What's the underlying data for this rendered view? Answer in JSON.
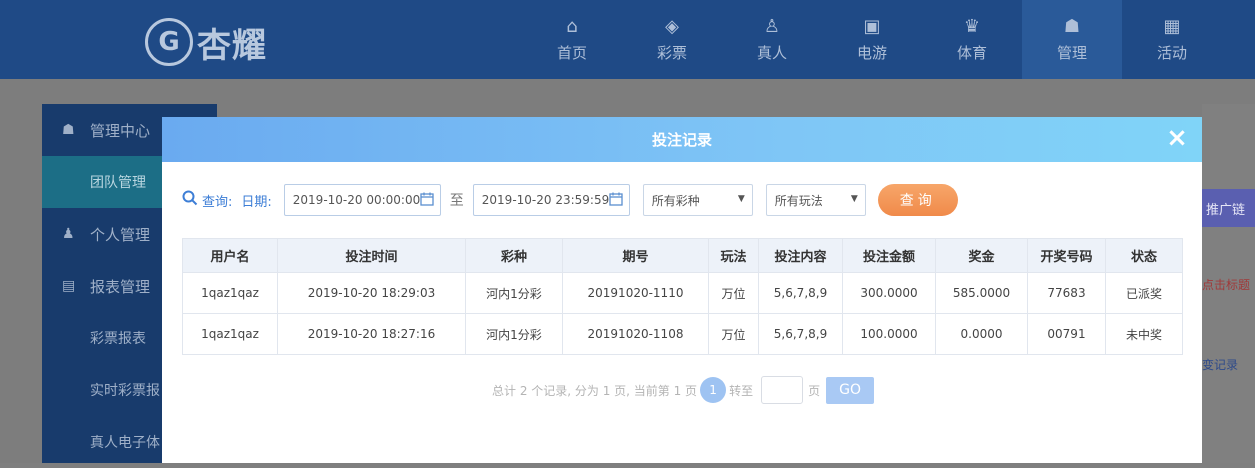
{
  "brand": {
    "emblem": "G",
    "name": "杏耀"
  },
  "nav": [
    {
      "label": "首页",
      "icon": "home-icon",
      "glyph": "⌂"
    },
    {
      "label": "彩票",
      "icon": "ticket-icon",
      "glyph": "◈"
    },
    {
      "label": "真人",
      "icon": "user-icon",
      "glyph": "♙"
    },
    {
      "label": "电游",
      "icon": "slot-machine-icon",
      "glyph": "▣"
    },
    {
      "label": "体育",
      "icon": "trophy-icon",
      "glyph": "♛"
    },
    {
      "label": "管理",
      "icon": "group-icon",
      "glyph": "☗"
    },
    {
      "label": "活动",
      "icon": "gift-icon",
      "glyph": "▦"
    }
  ],
  "sidebar": {
    "items": [
      {
        "label": "管理中心",
        "icon": "group-icon",
        "glyph": "☗"
      },
      {
        "label": "团队管理"
      },
      {
        "label": "个人管理",
        "icon": "person-icon",
        "glyph": "♟"
      },
      {
        "label": "报表管理",
        "icon": "report-icon",
        "glyph": "▤"
      },
      {
        "label": "彩票报表"
      },
      {
        "label": "实时彩票报"
      },
      {
        "label": "真人电子体"
      }
    ]
  },
  "right_panel": {
    "button": "推广链",
    "red_text": "点击标题",
    "link": "变记录"
  },
  "modal": {
    "title": "投注记录",
    "close": "×",
    "filter": {
      "query_label": "查询:",
      "date_label": "日期:",
      "start": "2019-10-20 00:00:00",
      "to": "至",
      "end": "2019-10-20 23:59:59",
      "lottery_select": "所有彩种",
      "play_select": "所有玩法",
      "query_button": "查询"
    },
    "table": {
      "headers": [
        "用户名",
        "投注时间",
        "彩种",
        "期号",
        "玩法",
        "投注内容",
        "投注金额",
        "奖金",
        "开奖号码",
        "状态"
      ],
      "rows": [
        [
          "1qaz1qaz",
          "2019-10-20 18:29:03",
          "河内1分彩",
          "20191020-1110",
          "万位",
          "5,6,7,8,9",
          "300.0000",
          "585.0000",
          "77683",
          "已派奖"
        ],
        [
          "1qaz1qaz",
          "2019-10-20 18:27:16",
          "河内1分彩",
          "20191020-1108",
          "万位",
          "5,6,7,8,9",
          "100.0000",
          "0.0000",
          "00791",
          "未中奖"
        ]
      ]
    },
    "pager": {
      "summary": "总计 2 个记录, 分为 1 页, 当前第 1 页",
      "current": "1",
      "goto_label": "转至",
      "page_unit": "页",
      "go": "GO"
    }
  },
  "colors": {
    "header_bg": "#1f4a86",
    "modal_head": "#7fc6f6",
    "status_paid": "#e07a2e",
    "accent_blue": "#3d7ed6"
  }
}
